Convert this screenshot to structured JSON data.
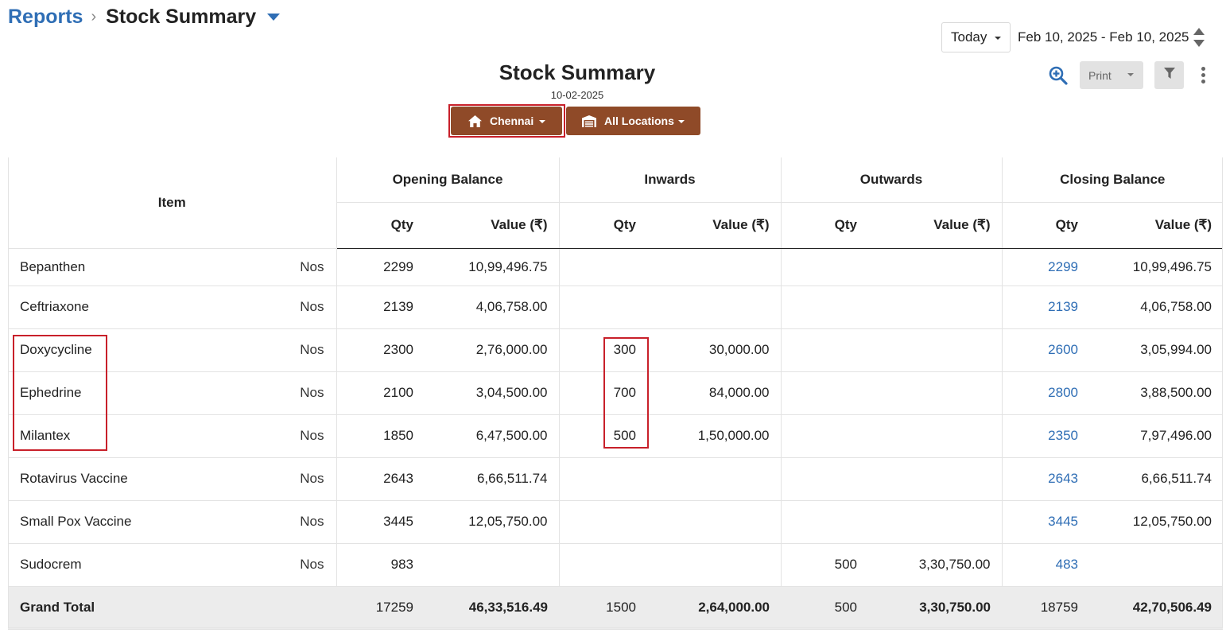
{
  "breadcrumb": {
    "parent": "Reports",
    "separator": "›",
    "current": "Stock Summary"
  },
  "date_filter": {
    "preset": "Today",
    "range": "Feb 10, 2025 - Feb 10, 2025"
  },
  "report": {
    "title": "Stock Summary",
    "date": "10-02-2025"
  },
  "location_buttons": {
    "branch": "Chennai",
    "locations": "All Locations"
  },
  "toolbar": {
    "print_label": "Print"
  },
  "table": {
    "item_header": "Item",
    "groups": [
      "Opening Balance",
      "Inwards",
      "Outwards",
      "Closing Balance"
    ],
    "sub_qty": "Qty",
    "sub_value": "Value (₹)",
    "rows": [
      {
        "item": "Bepanthen",
        "unit": "Nos",
        "ob_qty": "2299",
        "ob_val": "10,99,496.75",
        "in_qty": "",
        "in_val": "",
        "out_qty": "",
        "out_val": "",
        "cb_qty": "2299",
        "cb_val": "10,99,496.75"
      },
      {
        "item": "Ceftriaxone",
        "unit": "Nos",
        "ob_qty": "2139",
        "ob_val": "4,06,758.00",
        "in_qty": "",
        "in_val": "",
        "out_qty": "",
        "out_val": "",
        "cb_qty": "2139",
        "cb_val": "4,06,758.00"
      },
      {
        "item": "Doxycycline",
        "unit": "Nos",
        "ob_qty": "2300",
        "ob_val": "2,76,000.00",
        "in_qty": "300",
        "in_val": "30,000.00",
        "out_qty": "",
        "out_val": "",
        "cb_qty": "2600",
        "cb_val": "3,05,994.00"
      },
      {
        "item": "Ephedrine",
        "unit": "Nos",
        "ob_qty": "2100",
        "ob_val": "3,04,500.00",
        "in_qty": "700",
        "in_val": "84,000.00",
        "out_qty": "",
        "out_val": "",
        "cb_qty": "2800",
        "cb_val": "3,88,500.00"
      },
      {
        "item": "Milantex",
        "unit": "Nos",
        "ob_qty": "1850",
        "ob_val": "6,47,500.00",
        "in_qty": "500",
        "in_val": "1,50,000.00",
        "out_qty": "",
        "out_val": "",
        "cb_qty": "2350",
        "cb_val": "7,97,496.00"
      },
      {
        "item": "Rotavirus Vaccine",
        "unit": "Nos",
        "ob_qty": "2643",
        "ob_val": "6,66,511.74",
        "in_qty": "",
        "in_val": "",
        "out_qty": "",
        "out_val": "",
        "cb_qty": "2643",
        "cb_val": "6,66,511.74"
      },
      {
        "item": "Small Pox Vaccine",
        "unit": "Nos",
        "ob_qty": "3445",
        "ob_val": "12,05,750.00",
        "in_qty": "",
        "in_val": "",
        "out_qty": "",
        "out_val": "",
        "cb_qty": "3445",
        "cb_val": "12,05,750.00"
      },
      {
        "item": "Sudocrem",
        "unit": "Nos",
        "ob_qty": "983",
        "ob_val": "",
        "in_qty": "",
        "in_val": "",
        "out_qty": "500",
        "out_val": "3,30,750.00",
        "cb_qty": "483",
        "cb_val": ""
      }
    ],
    "total": {
      "label": "Grand Total",
      "ob_qty": "17259",
      "ob_val": "46,33,516.49",
      "in_qty": "1500",
      "in_val": "2,64,000.00",
      "out_qty": "500",
      "out_val": "3,30,750.00",
      "cb_qty": "18759",
      "cb_val": "42,70,506.49"
    }
  },
  "colors": {
    "link": "#2f6eb5",
    "location_button": "#8f4a28",
    "highlight": "#c8202a",
    "total_row_bg": "#ececec"
  },
  "icons": {
    "breadcrumb_dropdown": "caret-down-icon",
    "date_stepper": "sort-icon",
    "zoom": "zoom-in-icon",
    "filter": "filter-icon",
    "more": "more-vertical-icon",
    "branch": "home-icon",
    "locations": "warehouse-icon"
  }
}
